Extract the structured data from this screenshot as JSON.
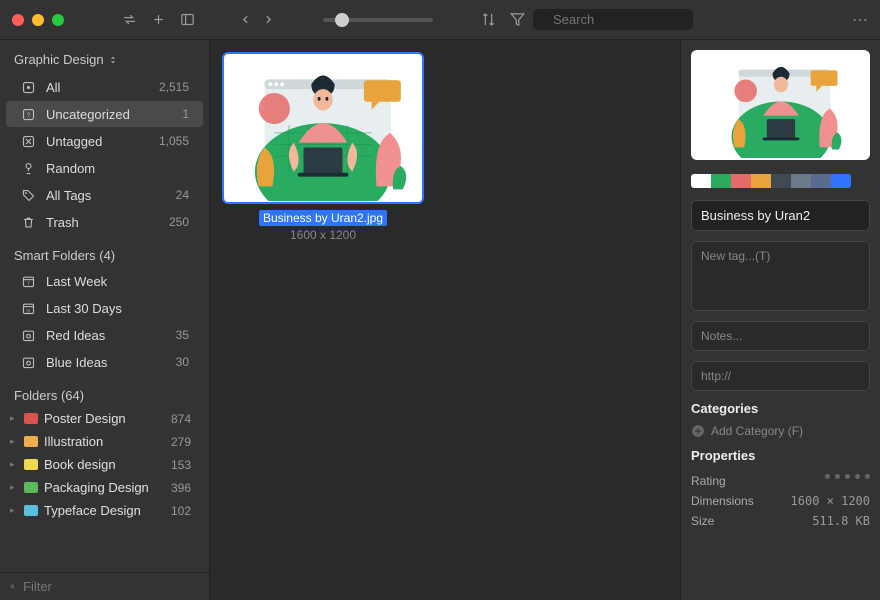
{
  "toolbar": {
    "search_placeholder": "Search"
  },
  "sidebar": {
    "library_name": "Graphic Design",
    "system": [
      {
        "icon": "all",
        "label": "All",
        "count": "2,515"
      },
      {
        "icon": "uncat",
        "label": "Uncategorized",
        "count": "1",
        "selected": true
      },
      {
        "icon": "untag",
        "label": "Untagged",
        "count": "1,055"
      },
      {
        "icon": "random",
        "label": "Random",
        "count": ""
      },
      {
        "icon": "tags",
        "label": "All Tags",
        "count": "24"
      },
      {
        "icon": "trash",
        "label": "Trash",
        "count": "250"
      }
    ],
    "smart_header": "Smart Folders (4)",
    "smart": [
      {
        "icon": "cal7",
        "label": "Last Week",
        "count": ""
      },
      {
        "icon": "cal31",
        "label": "Last 30 Days",
        "count": ""
      },
      {
        "icon": "idea",
        "label": "Red Ideas",
        "count": "35"
      },
      {
        "icon": "idea",
        "label": "Blue Ideas",
        "count": "30"
      }
    ],
    "folders_header": "Folders (64)",
    "folders": [
      {
        "color": "#d9534f",
        "label": "Poster Design",
        "count": "874"
      },
      {
        "color": "#f0ad4e",
        "label": "Illustration",
        "count": "279"
      },
      {
        "color": "#f0d94e",
        "label": "Book design",
        "count": "153"
      },
      {
        "color": "#5cb85c",
        "label": "Packaging Design",
        "count": "396"
      },
      {
        "color": "#5bc0de",
        "label": "Typeface Design",
        "count": "102"
      }
    ],
    "filter_placeholder": "Filter"
  },
  "content": {
    "item": {
      "name": "Business by Uran2.jpg",
      "dimensions": "1600 x 1200"
    }
  },
  "inspector": {
    "swatches": [
      "#ffffff",
      "#2aab62",
      "#e66a6a",
      "#e8a33d",
      "#3f4a52",
      "#6b7a8a",
      "#5a6a8f",
      "#2f74ff"
    ],
    "name_value": "Business by Uran2",
    "tag_placeholder": "New tag...(T)",
    "notes_placeholder": "Notes...",
    "url_placeholder": "http://",
    "categories_label": "Categories",
    "add_category_label": "Add Category (F)",
    "properties_label": "Properties",
    "properties": {
      "rating_label": "Rating",
      "dimensions_label": "Dimensions",
      "dimensions_value": "1600 × 1200",
      "size_label": "Size",
      "size_value": "511.8 KB"
    }
  }
}
